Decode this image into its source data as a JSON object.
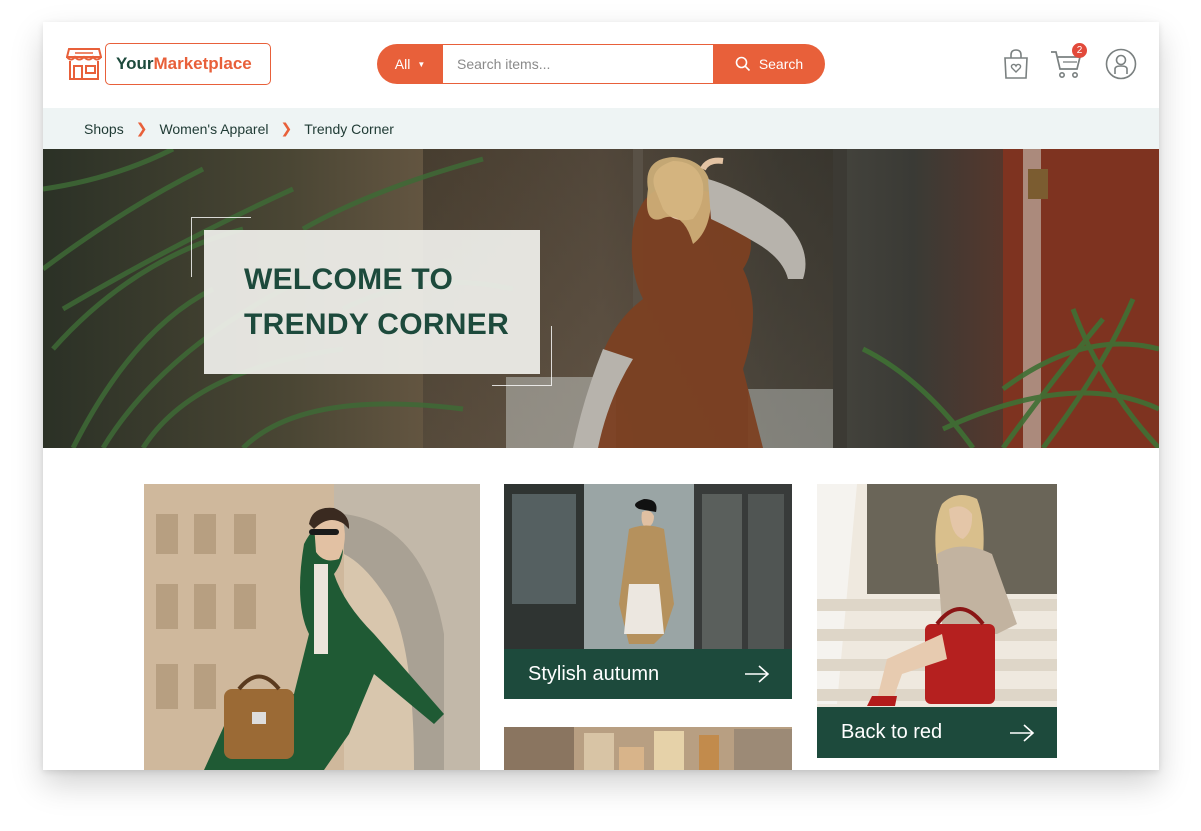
{
  "header": {
    "logo": {
      "part1": "Your",
      "part2": "Marketplace",
      "icon": "storefront-icon"
    },
    "search": {
      "category_label": "All",
      "placeholder": "Search items...",
      "value": "",
      "button_label": "Search"
    },
    "icons": {
      "wishlist": "shopping-bag-heart-icon",
      "cart": "cart-icon",
      "account": "user-circle-icon"
    },
    "cart_count": "2"
  },
  "breadcrumb": [
    "Shops",
    "Women's Apparel",
    "Trendy Corner"
  ],
  "hero": {
    "title_line1": "WELCOME TO",
    "title_line2": "TRENDY CORNER"
  },
  "tiles": [
    {
      "label": ""
    },
    {
      "label": "Stylish autumn"
    },
    {
      "label": "Back to red"
    },
    {
      "label": ""
    }
  ],
  "colors": {
    "accent": "#e8603a",
    "brand_green": "#1d4a3c",
    "breadcrumb_bg": "#eef4f4",
    "badge": "#e24a3b"
  }
}
